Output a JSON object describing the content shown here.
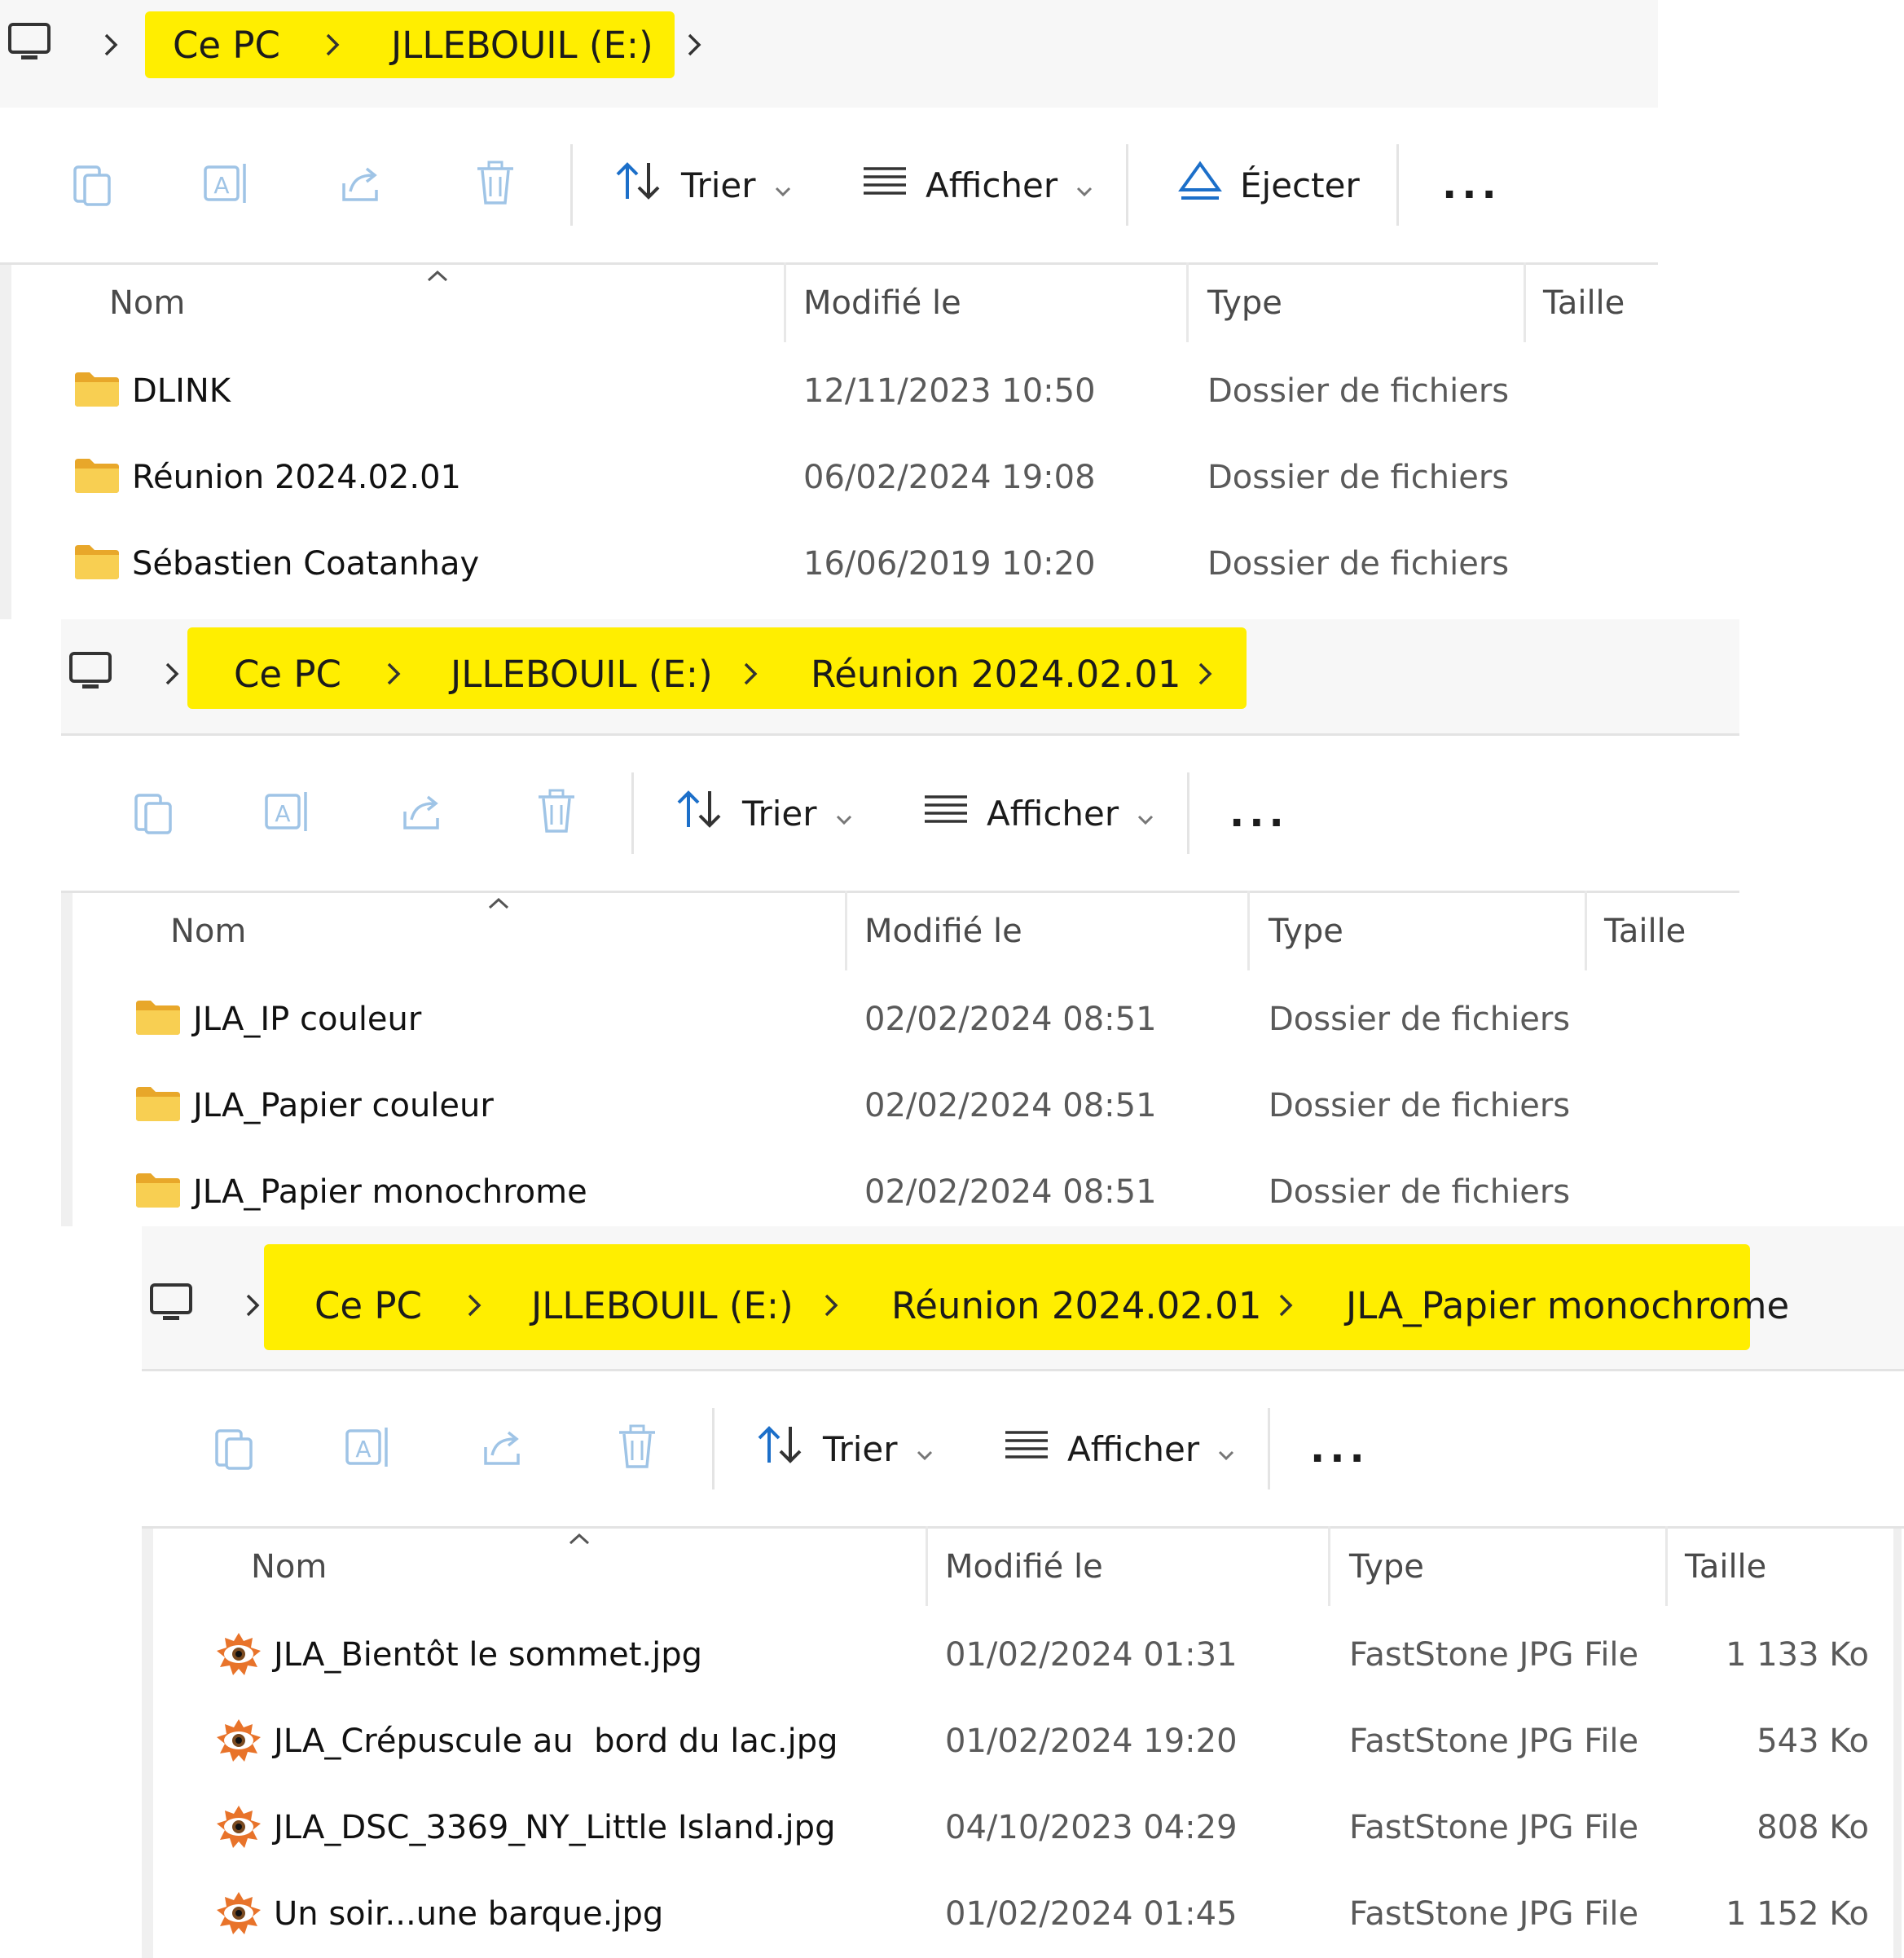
{
  "panels": [
    {
      "breadcrumb": [
        "Ce PC",
        "JLLEBOUIL (E:)"
      ],
      "toolbar": {
        "sort_label": "Trier",
        "view_label": "Afficher",
        "eject_label": "Éjecter",
        "more_label": "..."
      },
      "columns": {
        "name": "Nom",
        "modified": "Modifié le",
        "type": "Type",
        "size": "Taille"
      },
      "rows": [
        {
          "name": "DLINK",
          "modified": "12/11/2023 10:50",
          "type": "Dossier de fichiers",
          "size": ""
        },
        {
          "name": "Réunion 2024.02.01",
          "modified": "06/02/2024 19:08",
          "type": "Dossier de fichiers",
          "size": ""
        },
        {
          "name": "Sébastien Coatanhay",
          "modified": "16/06/2019 10:20",
          "type": "Dossier de fichiers",
          "size": ""
        }
      ]
    },
    {
      "breadcrumb": [
        "Ce PC",
        "JLLEBOUIL (E:)",
        "Réunion 2024.02.01"
      ],
      "toolbar": {
        "sort_label": "Trier",
        "view_label": "Afficher",
        "more_label": "..."
      },
      "columns": {
        "name": "Nom",
        "modified": "Modifié le",
        "type": "Type",
        "size": "Taille"
      },
      "rows": [
        {
          "name": "JLA_IP couleur",
          "modified": "02/02/2024 08:51",
          "type": "Dossier de fichiers",
          "size": ""
        },
        {
          "name": "JLA_Papier couleur",
          "modified": "02/02/2024 08:51",
          "type": "Dossier de fichiers",
          "size": ""
        },
        {
          "name": "JLA_Papier monochrome",
          "modified": "02/02/2024 08:51",
          "type": "Dossier de fichiers",
          "size": ""
        }
      ]
    },
    {
      "breadcrumb": [
        "Ce PC",
        "JLLEBOUIL (E:)",
        "Réunion 2024.02.01",
        "JLA_Papier monochrome"
      ],
      "toolbar": {
        "sort_label": "Trier",
        "view_label": "Afficher",
        "more_label": "..."
      },
      "columns": {
        "name": "Nom",
        "modified": "Modifié le",
        "type": "Type",
        "size": "Taille"
      },
      "rows": [
        {
          "name": "JLA_Bientôt le sommet.jpg",
          "modified": "01/02/2024 01:31",
          "type": "FastStone JPG File",
          "size": "1 133 Ko"
        },
        {
          "name": "JLA_Crépuscule au  bord du lac.jpg",
          "modified": "01/02/2024 19:20",
          "type": "FastStone JPG File",
          "size": "543 Ko"
        },
        {
          "name": "JLA_DSC_3369_NY_Little Island.jpg",
          "modified": "04/10/2023 04:29",
          "type": "FastStone JPG File",
          "size": "808 Ko"
        },
        {
          "name": "Un soir...une barque.jpg",
          "modified": "01/02/2024 01:45",
          "type": "FastStone JPG File",
          "size": "1 152 Ko"
        }
      ]
    }
  ],
  "colors": {
    "highlight": "#ffee00",
    "folder": "#f4c542",
    "disabled_icon": "#9fc4e6",
    "eject_icon": "#1c6fc9"
  },
  "icons": {
    "this_pc": "monitor-icon",
    "separator": "chevron-right-icon",
    "copy": "copy-icon",
    "rename": "rename-icon",
    "share": "share-icon",
    "delete": "trash-icon",
    "sort": "sort-arrows-icon",
    "view": "list-lines-icon",
    "eject": "eject-icon",
    "folder": "folder-icon",
    "image_file": "faststone-eye-icon"
  }
}
